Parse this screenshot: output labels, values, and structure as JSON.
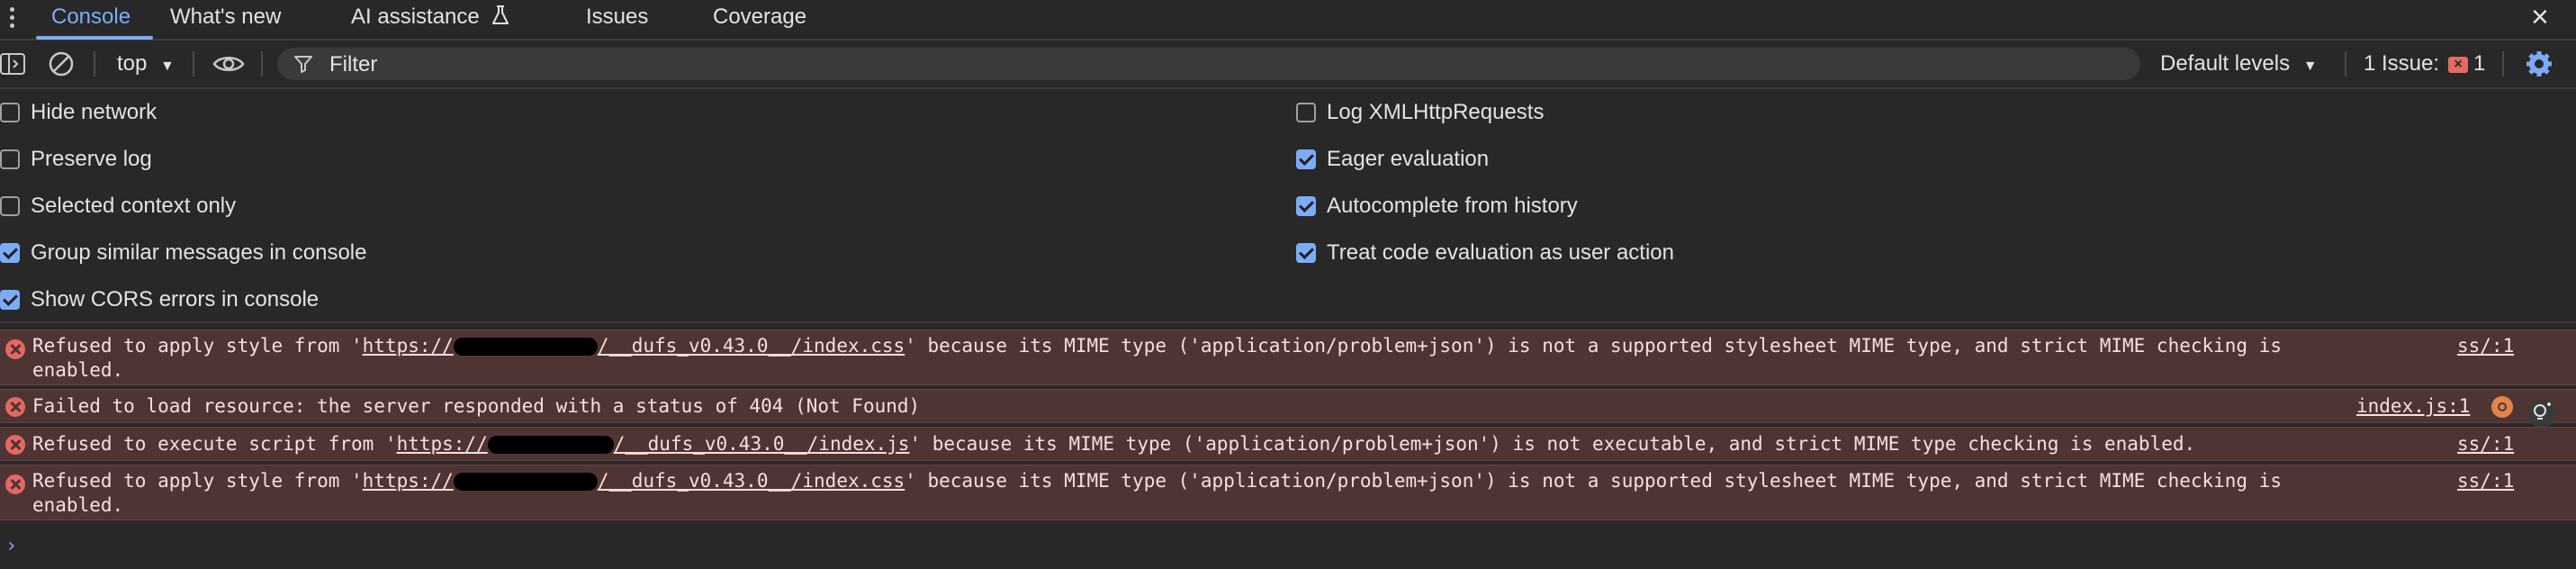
{
  "tabs": [
    "Console",
    "What's new",
    "AI assistance",
    "Issues",
    "Coverage"
  ],
  "toolbar": {
    "context": "top",
    "filter_placeholder": "Filter",
    "levels": "Default levels",
    "issues_label": "1 Issue:",
    "issues_count": "1"
  },
  "settings": {
    "left": [
      {
        "label": "Hide network",
        "checked": false
      },
      {
        "label": "Preserve log",
        "checked": false
      },
      {
        "label": "Selected context only",
        "checked": false
      },
      {
        "label": "Group similar messages in console",
        "checked": true
      },
      {
        "label": "Show CORS errors in console",
        "checked": true
      }
    ],
    "right": [
      {
        "label": "Log XMLHttpRequests",
        "checked": false
      },
      {
        "label": "Eager evaluation",
        "checked": true
      },
      {
        "label": "Autocomplete from history",
        "checked": true
      },
      {
        "label": "Treat code evaluation as user action",
        "checked": true
      }
    ]
  },
  "messages": [
    {
      "pre": "Refused to apply style from '",
      "url_a": "https://",
      "url_b": "/__dufs_v0.43.0__/index.css",
      "post": "' because its MIME type ('application/problem+json') is not a supported stylesheet MIME type, and strict MIME checking is enabled.",
      "source": "ss/:1"
    },
    {
      "text": "Failed to load resource: the server responded with a status of 404 (Not Found)",
      "source": "index.js:1"
    },
    {
      "pre": "Refused to execute script from '",
      "url_a": "https://",
      "url_b": "/__dufs_v0.43.0__/index.js",
      "post": "' because its MIME type ('application/problem+json') is not executable, and strict MIME type checking is enabled.",
      "source": "ss/:1"
    },
    {
      "pre": "Refused to apply style from '",
      "url_a": "https://",
      "url_b": "/__dufs_v0.43.0__/index.css",
      "post": "' because its MIME type ('application/problem+json') is not a supported stylesheet MIME type, and strict MIME checking is enabled.",
      "source": "ss/:1"
    }
  ],
  "colors": {
    "accent": "#7cacf8",
    "error": "#e46962",
    "error_bg": "#4e3534"
  }
}
